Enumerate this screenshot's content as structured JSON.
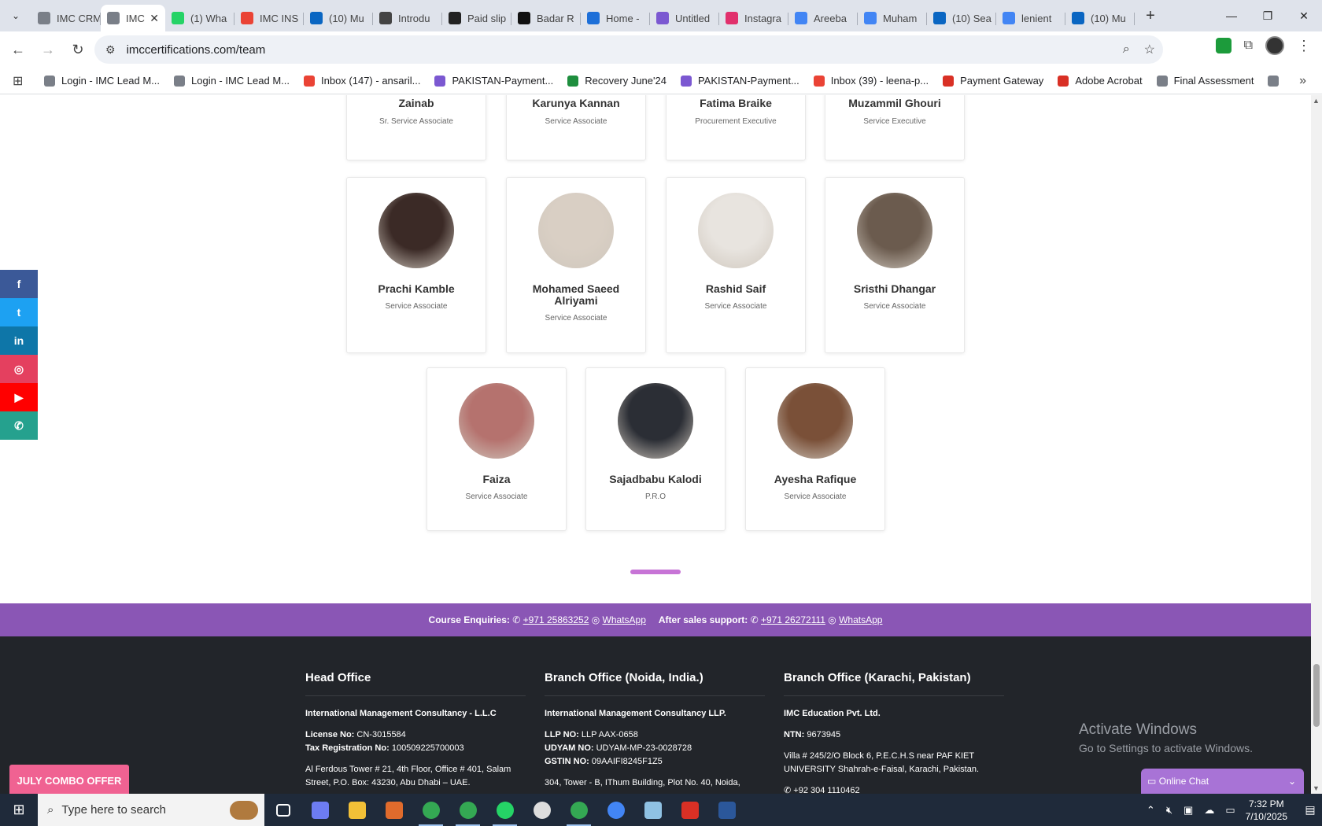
{
  "browser": {
    "tabs": [
      {
        "title": "IMC CRM",
        "color": "#7a7f88"
      },
      {
        "title": "IMC",
        "color": "#7a7f88",
        "active": true
      },
      {
        "title": "(1) Wha",
        "color": "#25d366"
      },
      {
        "title": "IMC INS",
        "color": "#ea4335"
      },
      {
        "title": "(10) Mu",
        "color": "#0a66c2"
      },
      {
        "title": "Introdu",
        "color": "#444444"
      },
      {
        "title": "Paid slip",
        "color": "#222222"
      },
      {
        "title": "Badar R",
        "color": "#111111"
      },
      {
        "title": "Home -",
        "color": "#1d6fd8"
      },
      {
        "title": "Untitled",
        "color": "#7b58d1"
      },
      {
        "title": "Instagra",
        "color": "#e1306c"
      },
      {
        "title": "Areeba",
        "color": "#4285f4"
      },
      {
        "title": "Muham",
        "color": "#4285f4"
      },
      {
        "title": "(10) Sea",
        "color": "#0a66c2"
      },
      {
        "title": "lenient",
        "color": "#4285f4"
      },
      {
        "title": "(10) Mu",
        "color": "#0a66c2"
      }
    ],
    "url": "imccertifications.com/team",
    "bookmarks": [
      {
        "label": "Login - IMC Lead M...",
        "color": "#7a7f88"
      },
      {
        "label": "Login - IMC Lead M...",
        "color": "#7a7f88"
      },
      {
        "label": "Inbox (147) - ansaril...",
        "color": "#ea4335"
      },
      {
        "label": "PAKISTAN-Payment...",
        "color": "#7b58d1"
      },
      {
        "label": "Recovery June'24",
        "color": "#1e8e3e"
      },
      {
        "label": "PAKISTAN-Payment...",
        "color": "#7b58d1"
      },
      {
        "label": "Inbox (39) - leena-p...",
        "color": "#ea4335"
      },
      {
        "label": "Payment Gateway",
        "color": "#d93025"
      },
      {
        "label": "Adobe Acrobat",
        "color": "#d93025"
      },
      {
        "label": "Final Assessment",
        "color": "#7a7f88"
      }
    ]
  },
  "team": {
    "top_row": [
      {
        "name": "Zainab",
        "role": "Sr. Service Associate"
      },
      {
        "name": "Karunya Kannan",
        "role": "Service Associate"
      },
      {
        "name": "Fatima Braike",
        "role": "Procurement Executive"
      },
      {
        "name": "Muzammil Ghouri",
        "role": "Service Executive"
      }
    ],
    "middle_row": [
      {
        "name": "Prachi Kamble",
        "role": "Service Associate",
        "tone": "#3b2a26"
      },
      {
        "name": "Mohamed Saeed Alriyami",
        "role": "Service Associate",
        "tone": "#d9cfc4"
      },
      {
        "name": "Rashid Saif",
        "role": "Service Associate",
        "tone": "#e8e4df"
      },
      {
        "name": "Sristhi Dhangar",
        "role": "Service Associate",
        "tone": "#6b5b4e"
      }
    ],
    "bottom_row": [
      {
        "name": "Faiza",
        "role": "Service Associate",
        "tone": "#b5726e"
      },
      {
        "name": "Sajadbabu Kalodi",
        "role": "P.R.O",
        "tone": "#2b2e35"
      },
      {
        "name": "Ayesha Rafique",
        "role": "Service Associate",
        "tone": "#7a5038"
      }
    ]
  },
  "social": [
    {
      "icon": "facebook-icon",
      "glyph": "f",
      "color": "#3b5998"
    },
    {
      "icon": "twitter-icon",
      "glyph": "t",
      "color": "#1da1f2"
    },
    {
      "icon": "linkedin-icon",
      "glyph": "in",
      "color": "#0e76a8"
    },
    {
      "icon": "instagram-icon",
      "glyph": "◎",
      "color": "#e4405f"
    },
    {
      "icon": "youtube-icon",
      "glyph": "▶",
      "color": "#ff0000"
    },
    {
      "icon": "whatsapp-icon",
      "glyph": "✆",
      "color": "#25a18e"
    }
  ],
  "contact": {
    "course_label": "Course Enquiries:",
    "course_phone": "+971 25863252",
    "course_whatsapp": "WhatsApp",
    "support_label": "After sales support:",
    "support_phone": "+971 26272111",
    "support_whatsapp": "WhatsApp"
  },
  "footer": {
    "head": {
      "title": "Head Office",
      "company": "International Management Consultancy - L.L.C",
      "license_label": "License No:",
      "license": "CN-3015584",
      "tax_label": "Tax Registration No:",
      "tax": "100509225700003",
      "address": "Al Ferdous Tower # 21, 4th Floor, Office # 401, Salam Street, P.O. Box: 43230, Abu Dhabi – UAE."
    },
    "noida": {
      "title": "Branch Office (Noida, India.)",
      "company": "International Management Consultancy LLP.",
      "llp_label": "LLP NO:",
      "llp": "LLP AAX-0658",
      "udyam_label": "UDYAM NO:",
      "udyam": "UDYAM-MP-23-0028728",
      "gstin_label": "GSTIN NO:",
      "gstin": "09AAIFI8245F1Z5",
      "address": "304, Tower - B, IThum Building, Plot No. 40, Noida,"
    },
    "karachi": {
      "title": "Branch Office (Karachi, Pakistan)",
      "company": "IMC Education Pvt. Ltd.",
      "ntn_label": "NTN:",
      "ntn": "9673945",
      "address": "Villa # 245/2/O Block 6, P.E.C.H.S near PAF KIET UNIVERSITY Shahrah-e-Faisal, Karachi, Pakistan.",
      "phone": "+92 304 1110462"
    }
  },
  "overlays": {
    "activate_title": "Activate Windows",
    "activate_sub": "Go to Settings to activate Windows.",
    "combo_offer": "JULY COMBO OFFER",
    "chat": "Online Chat"
  },
  "taskbar": {
    "search_placeholder": "Type here to search",
    "time": "7:32 PM",
    "date": "7/10/2025",
    "apps": [
      {
        "name": "task-view-icon",
        "color": "#ffffff"
      },
      {
        "name": "copilot-icon",
        "color": "#6d7cf2"
      },
      {
        "name": "file-explorer-icon",
        "color": "#f2c037"
      },
      {
        "name": "app-icon",
        "color": "#e06b2c"
      },
      {
        "name": "chrome-icon",
        "color": "#34a853",
        "open": true
      },
      {
        "name": "chrome-icon",
        "color": "#34a853",
        "open": true
      },
      {
        "name": "whatsapp-icon",
        "color": "#25d366",
        "open": true
      },
      {
        "name": "clock-app-icon",
        "color": "#dddddd"
      },
      {
        "name": "chrome-icon",
        "color": "#34a853",
        "open": true
      },
      {
        "name": "chrome-icon",
        "color": "#4285f4"
      },
      {
        "name": "notepad-icon",
        "color": "#8fc1e3"
      },
      {
        "name": "acrobat-icon",
        "color": "#d93025"
      },
      {
        "name": "word-icon",
        "color": "#2b579a"
      }
    ]
  }
}
